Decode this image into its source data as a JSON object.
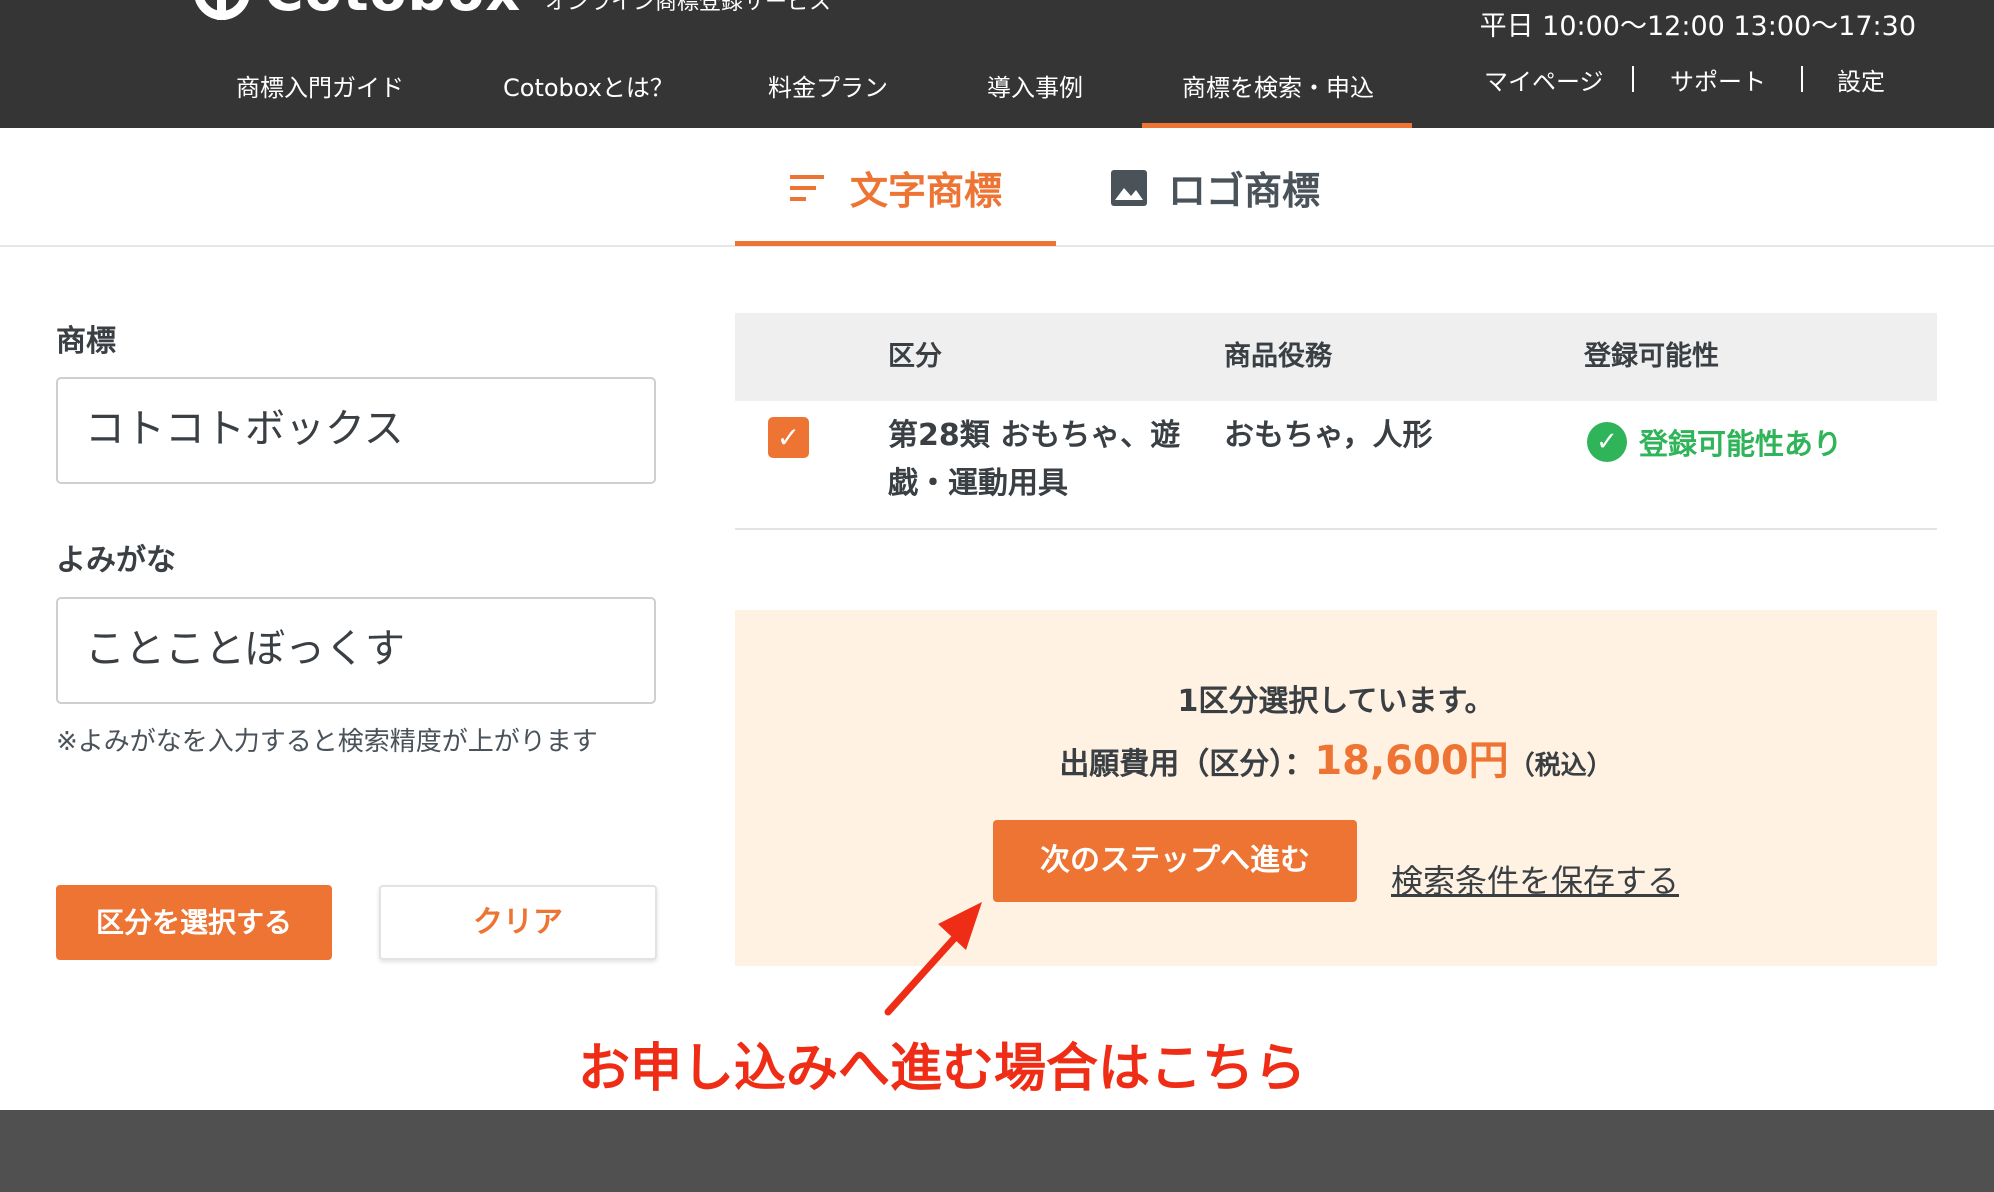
{
  "header": {
    "logo_text": "Cotobox",
    "tagline": "オンライン商標登録サービス",
    "hours": "平日 10:00〜12:00 13:00〜17:30",
    "nav": [
      "商標入門ガイド",
      "Cotoboxとは？",
      "料金プラン",
      "導入事例",
      "商標を検索・申込"
    ],
    "util": [
      "マイページ",
      "サポート",
      "設定"
    ]
  },
  "tabs": {
    "word": "文字商標",
    "logo": "ロゴ商標"
  },
  "form": {
    "trademark_label": "商標",
    "trademark_value": "コトコトボックス",
    "reading_label": "よみがな",
    "reading_value": "ことことぼっくす",
    "hint": "※よみがなを入力すると検索精度が上がります",
    "select_button": "区分を選択する",
    "clear_button": "クリア"
  },
  "table": {
    "headers": [
      "区分",
      "商品役務",
      "登録可能性"
    ],
    "rows": [
      {
        "checked": true,
        "class": "第28類 おもちゃ、遊戯・運動用具",
        "goods": "おもちゃ，人形",
        "status": "登録可能性あり"
      }
    ]
  },
  "summary": {
    "selected_text": "1区分選択しています。",
    "fee_label": "出願費用（区分）：",
    "fee_amount": "18,600円",
    "fee_tax": "（税込）",
    "next_button": "次のステップへ進む",
    "save_link": "検索条件を保存する"
  },
  "annotation": "お申し込みへ進む場合はこちら",
  "colors": {
    "accent": "#ed7433",
    "header_bg": "#353535",
    "success": "#2fb45a",
    "annotation": "#ef2d16",
    "summary_bg": "#fff2e2"
  }
}
